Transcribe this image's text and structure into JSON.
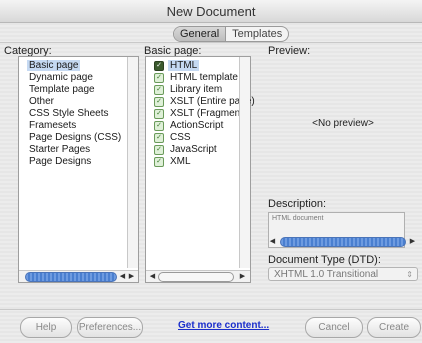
{
  "window": {
    "title": "New Document"
  },
  "tabs": [
    {
      "label": "General"
    },
    {
      "label": "Templates"
    }
  ],
  "category": {
    "heading": "Category:",
    "items": [
      "Basic page",
      "Dynamic page",
      "Template page",
      "Other",
      "CSS Style Sheets",
      "Framesets",
      "Page Designs (CSS)",
      "Starter Pages",
      "Page Designs"
    ],
    "selected_index": 0
  },
  "basic_page": {
    "heading": "Basic page:",
    "items": [
      "HTML",
      "HTML template",
      "Library item",
      "XSLT (Entire page)",
      "XSLT (Fragment)",
      "ActionScript",
      "CSS",
      "JavaScript",
      "XML"
    ],
    "selected_index": 0,
    "icon": "document-icon"
  },
  "preview": {
    "heading": "Preview:",
    "placeholder": "<No preview>"
  },
  "description": {
    "heading": "Description:",
    "text": "HTML document"
  },
  "doctype": {
    "heading": "Document Type (DTD):",
    "value": "XHTML 1.0 Transitional"
  },
  "buttons": {
    "help": "Help",
    "preferences": "Preferences...",
    "get_more": "Get more content...",
    "cancel": "Cancel",
    "create": "Create"
  },
  "colors": {
    "selection": "#c5d9f2",
    "scroll_thumb": "#6e9be0",
    "link": "#1a2ecc"
  }
}
